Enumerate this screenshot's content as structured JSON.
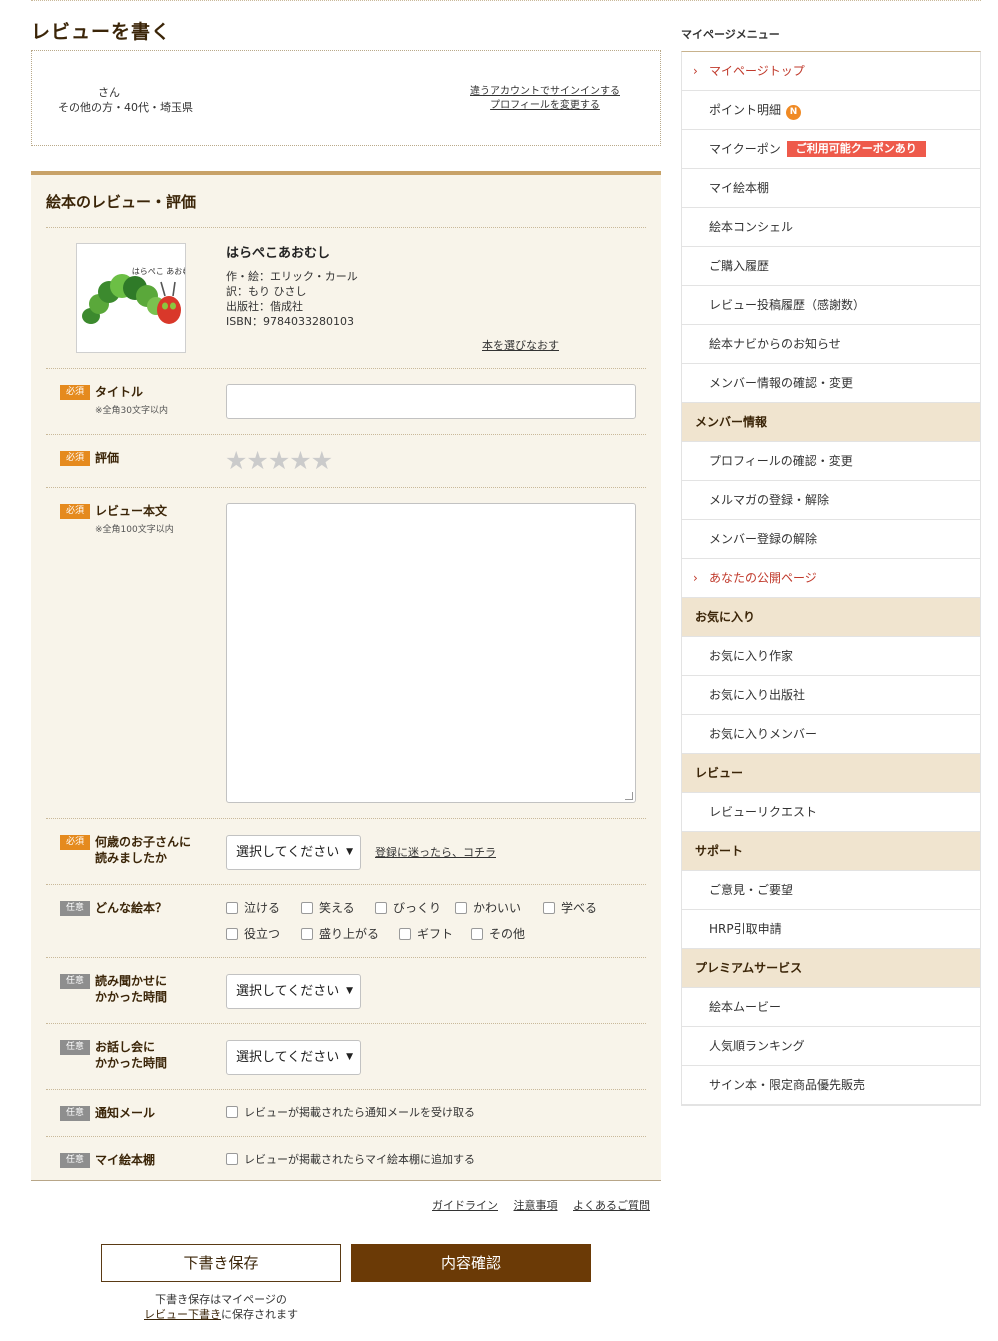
{
  "page": {
    "title": "レビューを書く"
  },
  "user": {
    "name": "さん",
    "info": "その他の方・40代・埼玉県",
    "switch_account": "違うアカウントでサインインする",
    "change_profile": "プロフィールを変更する"
  },
  "form": {
    "heading": "絵本のレビュー・評価",
    "book": {
      "title": "はらぺこあおむし",
      "author": "作・絵：エリック・カール",
      "translator": "訳：もり ひさし",
      "publisher": "出版社：偕成社",
      "isbn": "ISBN：9784033280103",
      "cover_text": "はらぺこ あおむし",
      "reselect": "本を選びなおす"
    },
    "badges": {
      "required": "必須",
      "optional": "任意"
    },
    "title_field": {
      "label": "タイトル",
      "note": "※全角30文字以内",
      "value": ""
    },
    "rating": {
      "label": "評価",
      "stars": "★★★★★",
      "value": 0,
      "max": 5
    },
    "body": {
      "label": "レビュー本文",
      "note": "※全角100文字以内",
      "value": ""
    },
    "child_age": {
      "label_line1": "何歳のお子さんに",
      "label_line2": "読みましたか",
      "selected": "選択してください",
      "help": "登録に迷ったら、コチラ"
    },
    "book_type": {
      "label": "どんな絵本？",
      "options": [
        "泣ける",
        "笑える",
        "びっくり",
        "かわいい",
        "学べる",
        "役立つ",
        "盛り上がる",
        "ギフト",
        "その他"
      ]
    },
    "read_time": {
      "label_line1": "読み聞かせに",
      "label_line2": "かかった時間",
      "selected": "選択してください"
    },
    "story_time": {
      "label_line1": "お話し会に",
      "label_line2": "かかった時間",
      "selected": "選択してください"
    },
    "notify": {
      "label": "通知メール",
      "option": "レビューが掲載されたら通知メールを受け取る"
    },
    "shelf": {
      "label": "マイ絵本棚",
      "option": "レビューが掲載されたらマイ絵本棚に追加する"
    }
  },
  "footer": {
    "links": [
      "ガイドライン",
      "注意事項",
      "よくあるご質問"
    ],
    "draft_button": "下書き保存",
    "confirm_button": "内容確認",
    "draft_note_line1": "下書き保存はマイページの",
    "draft_note_link": "レビュー下書き",
    "draft_note_line2_rest": "に保存されます"
  },
  "sidebar": {
    "heading": "マイページメニュー",
    "top": "マイページトップ",
    "points": "ポイント明細",
    "points_badge": "N",
    "coupon": "マイクーポン",
    "coupon_badge": "ご利用可能クーポンあり",
    "bookshelf": "マイ絵本棚",
    "concierge": "絵本コンシェル",
    "history": "ご購入履歴",
    "review_history": "レビュー投稿履歴（感謝数）",
    "news": "絵本ナビからのお知らせ",
    "member_info": "メンバー情報の確認・変更",
    "sec_member": "メンバー情報",
    "profile": "プロフィールの確認・変更",
    "mailmag": "メルマガの登録・解除",
    "unregister": "メンバー登録の解除",
    "public_page": "あなたの公開ページ",
    "sec_favorites": "お気に入り",
    "fav_author": "お気に入り作家",
    "fav_publisher": "お気に入り出版社",
    "fav_member": "お気に入りメンバー",
    "sec_review": "レビュー",
    "review_request": "レビューリクエスト",
    "sec_support": "サポート",
    "feedback": "ご意見・ご要望",
    "hrp": "HRP引取申請",
    "sec_premium": "プレミアムサービス",
    "movie": "絵本ムービー",
    "ranking": "人気順ランキング",
    "signed": "サイン本・限定商品優先販売"
  }
}
